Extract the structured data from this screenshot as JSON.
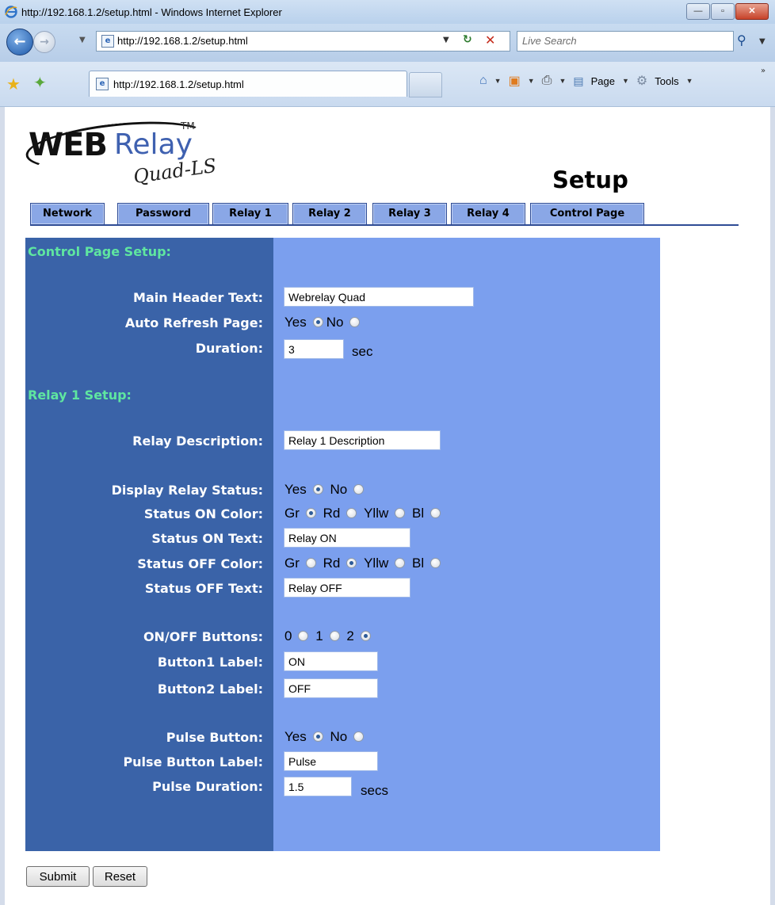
{
  "browser": {
    "window_title": "http://192.168.1.2/setup.html - Windows Internet Explorer",
    "address": "http://192.168.1.2/setup.html",
    "search_placeholder": "Live Search",
    "tab_title": "http://192.168.1.2/setup.html",
    "page_menu": "Page",
    "tools_menu": "Tools",
    "window_buttons": [
      "—",
      "▫",
      "✕"
    ]
  },
  "logo": {
    "brand_web": "WEB",
    "brand_relay": "Relay",
    "tm": "TM",
    "model": "Quad-LS"
  },
  "page_title": "Setup",
  "tabs": [
    {
      "label": "Network"
    },
    {
      "label": "Password"
    },
    {
      "label": "Relay 1"
    },
    {
      "label": "Relay 2"
    },
    {
      "label": "Relay 3"
    },
    {
      "label": "Relay 4"
    },
    {
      "label": "Control Page"
    }
  ],
  "control_page": {
    "section_title": "Control Page Setup:",
    "main_header_label": "Main Header Text:",
    "main_header_value": "Webrelay Quad",
    "auto_refresh_label": "Auto Refresh Page:",
    "auto_refresh_yes": "Yes",
    "auto_refresh_no": "No",
    "auto_refresh_selected": "Yes",
    "duration_label": "Duration:",
    "duration_value": "3",
    "duration_unit": "sec"
  },
  "relay1": {
    "section_title": "Relay 1 Setup:",
    "description_label": "Relay Description:",
    "description_value": "Relay 1 Description",
    "display_status_label": "Display Relay Status:",
    "display_status_yes": "Yes",
    "display_status_no": "No",
    "display_status_selected": "Yes",
    "on_color_label": "Status ON Color:",
    "color_options": [
      "Gr",
      "Rd",
      "Yllw",
      "Bl"
    ],
    "on_color_selected": "Gr",
    "on_text_label": "Status ON Text:",
    "on_text_value": "Relay ON",
    "off_color_label": "Status OFF Color:",
    "off_color_selected": "Rd",
    "off_text_label": "Status OFF Text:",
    "off_text_value": "Relay OFF",
    "buttons_label": "ON/OFF Buttons:",
    "button_options": [
      "0",
      "1",
      "2"
    ],
    "buttons_selected": "2",
    "button1_label": "Button1 Label:",
    "button1_value": "ON",
    "button2_label": "Button2 Label:",
    "button2_value": "OFF",
    "pulse_button_label": "Pulse Button:",
    "pulse_yes": "Yes",
    "pulse_no": "No",
    "pulse_selected": "Yes",
    "pulse_button_label_label": "Pulse Button Label:",
    "pulse_button_label_value": "Pulse",
    "pulse_duration_label": "Pulse Duration:",
    "pulse_duration_value": "1.5",
    "pulse_duration_unit": "secs"
  },
  "actions": {
    "submit": "Submit",
    "reset": "Reset"
  },
  "colors": {
    "panel_left": "#3a63a8",
    "panel_right": "#7b9fee",
    "section_heading": "#5fe6a0",
    "tab_fill": "#8aa7e6"
  }
}
